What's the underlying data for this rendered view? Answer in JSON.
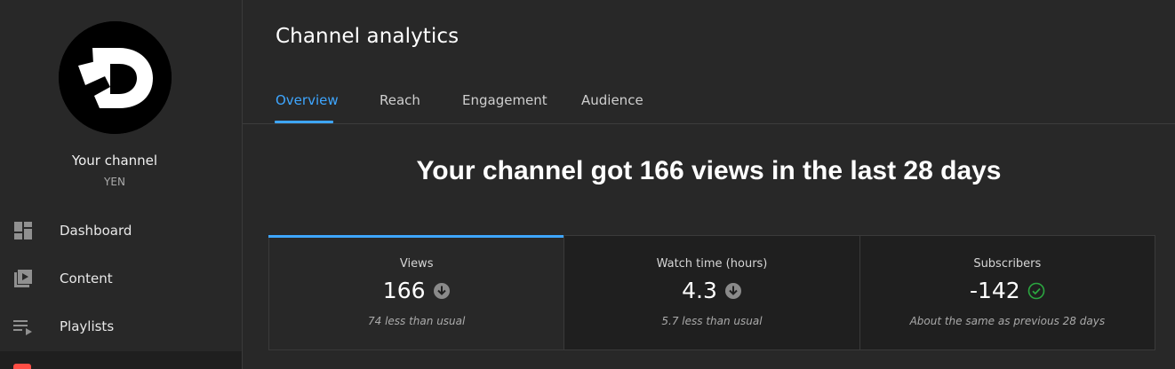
{
  "sidebar": {
    "channel_name": "Your channel",
    "channel_handle": "YEN",
    "avatar_icon": "channel-logo-d",
    "items": [
      {
        "label": "Dashboard",
        "icon": "dashboard-icon"
      },
      {
        "label": "Content",
        "icon": "content-icon"
      },
      {
        "label": "Playlists",
        "icon": "playlists-icon"
      }
    ]
  },
  "main": {
    "title": "Channel analytics",
    "tabs": [
      {
        "label": "Overview",
        "active": true
      },
      {
        "label": "Reach",
        "active": false
      },
      {
        "label": "Engagement",
        "active": false
      },
      {
        "label": "Audience",
        "active": false
      }
    ],
    "headline": "Your channel got 166 views in the last 28 days",
    "metrics": [
      {
        "label": "Views",
        "value": "166",
        "trend": "down",
        "note": "74 less than usual"
      },
      {
        "label": "Watch time (hours)",
        "value": "4.3",
        "trend": "down",
        "note": "5.7 less than usual"
      },
      {
        "label": "Subscribers",
        "value": "-142",
        "trend": "check",
        "note": "About the same as previous 28 days"
      }
    ]
  },
  "colors": {
    "accent": "#3ea6ff",
    "positive": "#2ba640",
    "background": "#282828"
  }
}
